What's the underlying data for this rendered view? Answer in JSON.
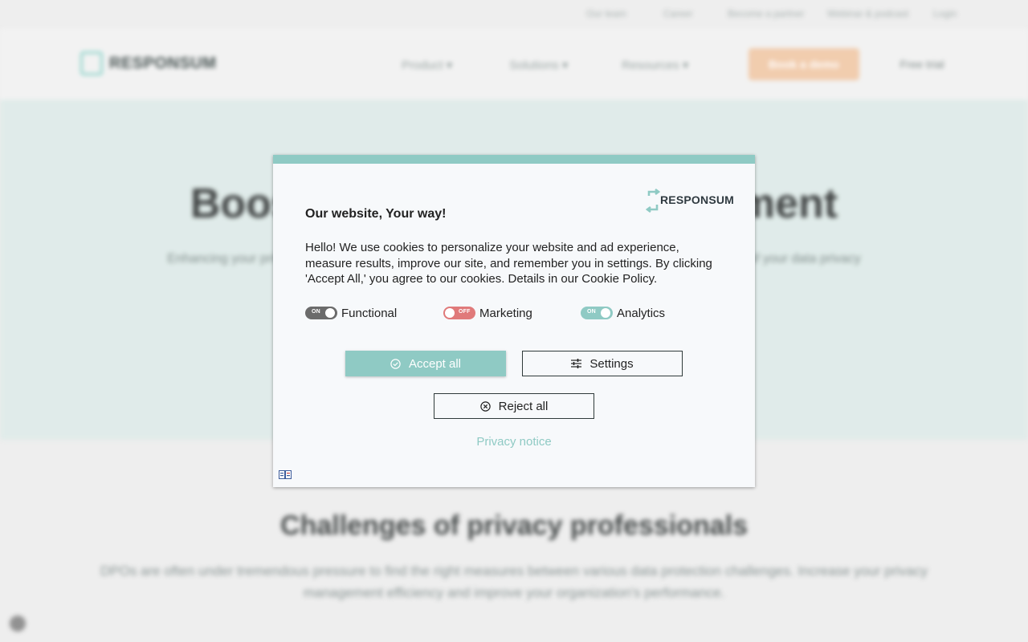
{
  "background": {
    "utility_links": [
      "Our team",
      "Career",
      "Become a partner",
      "Webinar & podcast",
      "Login"
    ],
    "logo_text": "RESPONSUM",
    "nav_items": [
      "Product",
      "Solutions",
      "Resources"
    ],
    "book_demo_label": "Book a demo",
    "free_trial_label": "Free trial",
    "hero_title": "Boost your privacy management",
    "hero_subtitle": "Enhancing your privacy management with a flexible and scalable tool that puts you back in the control of your data privacy",
    "challenges_title": "Challenges of privacy professionals",
    "challenges_text": "DPOs are often under tremendous pressure to find the right measures between various data protection challenges. Increase your privacy management efficiency and improve your organization's performance."
  },
  "modal": {
    "logo_text": "RESPONSUM",
    "title": "Our website, Your way!",
    "body": "Hello! We use cookies to personalize your website and ad experience, measure results, improve our site, and remember you in settings. By clicking 'Accept All,' you agree to our cookies. Details in our Cookie Policy.",
    "toggles": [
      {
        "label": "Functional",
        "state": "ON",
        "color": "#6b6b6b"
      },
      {
        "label": "Marketing",
        "state": "OFF",
        "color": "#e07a7a"
      },
      {
        "label": "Analytics",
        "state": "ON",
        "color": "#8fcac4"
      }
    ],
    "buttons": {
      "accept_label": "Accept all",
      "settings_label": "Settings",
      "reject_label": "Reject all"
    },
    "privacy_link": "Privacy notice",
    "accent_color": "#8fcac4"
  },
  "icons": {
    "accept": "check-circle-icon",
    "settings": "sliders-icon",
    "reject": "x-circle-icon",
    "language": "language-icon"
  }
}
